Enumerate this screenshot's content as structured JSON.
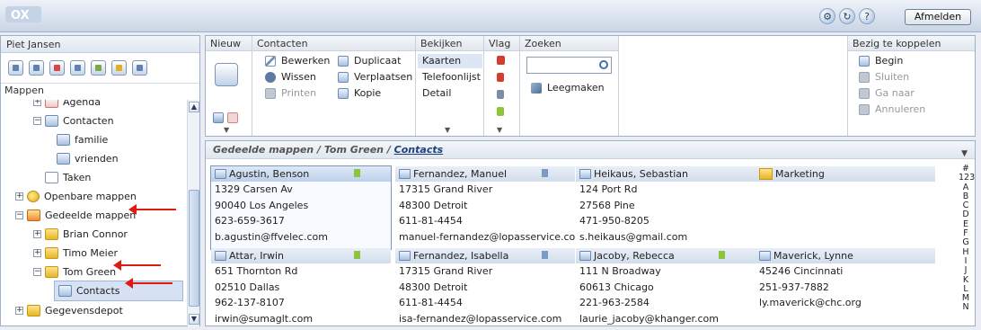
{
  "header": {
    "logo_text": "OX",
    "logout_label": "Afmelden",
    "icons": [
      "gear-icon",
      "refresh-icon",
      "help-icon"
    ]
  },
  "sidebar": {
    "user_name": "Piet Jansen",
    "folders_title": "Mappen",
    "app_icons": [
      "home-icon",
      "mail-icon",
      "calendar-icon",
      "contacts-icon",
      "tasks-icon",
      "files-icon",
      "options-icon"
    ],
    "tree": [
      {
        "label": "Agenda",
        "indent": 2
      },
      {
        "label": "Contacten",
        "indent": 2
      },
      {
        "label": "familie",
        "indent": 3
      },
      {
        "label": "vrienden",
        "indent": 3
      },
      {
        "label": "Taken",
        "indent": 2
      },
      {
        "label": "Openbare mappen",
        "indent": 1
      },
      {
        "label": "Gedeelde mappen",
        "indent": 1
      },
      {
        "label": "Brian Connor",
        "indent": 2
      },
      {
        "label": "Timo Meier",
        "indent": 2
      },
      {
        "label": "Tom Green",
        "indent": 2
      },
      {
        "label": "Contacts",
        "indent": 3
      },
      {
        "label": "Gegevensdepot",
        "indent": 1
      }
    ]
  },
  "toolbar": {
    "new_title": "Nieuw",
    "contacts_title": "Contacten",
    "edit": "Bewerken",
    "duplicate": "Duplicaat",
    "delete": "Wissen",
    "move": "Verplaatsen",
    "print": "Printen",
    "copy": "Kopie",
    "view_title": "Bekijken",
    "view_cards": "Kaarten",
    "view_phonelist": "Telefoonlijst",
    "view_detail": "Detail",
    "flag_title": "Vlag",
    "search_title": "Zoeken",
    "search_value": "",
    "clear": "Leegmaken",
    "connect_title": "Bezig te koppelen",
    "begin": "Begin",
    "close": "Sluiten",
    "goto": "Ga naar",
    "cancel": "Annuleren"
  },
  "content": {
    "breadcrumb_shared": "Gedeelde mappen",
    "breadcrumb_sep1": " / ",
    "breadcrumb_user": "Tom Green",
    "breadcrumb_sep2": " / ",
    "breadcrumb_folder": "Contacts",
    "alphabet": "#\n123\nA\nB\nC\nD\nE\nF\nG\nH\nI\nJ\nK\nL\nM\nN",
    "cards": [
      {
        "name": "Agustin, Benson",
        "l1": "1329 Carsen Av",
        "l2": "90040 Los Angeles",
        "l3": "623-659-3617",
        "l4": "b.agustin@ffvelec.com"
      },
      {
        "name": "Fernandez, Manuel",
        "l1": "17315 Grand River",
        "l2": "48300 Detroit",
        "l3": "611-81-4454",
        "l4": "manuel-fernandez@lopasservice.com"
      },
      {
        "name": "Heikaus, Sebastian",
        "l1": "124 Port Rd",
        "l2": "27568 Pine",
        "l3": "471-950-8205",
        "l4": "s.heikaus@gmail.com"
      },
      {
        "name": "Marketing",
        "l1": "",
        "l2": "",
        "l3": "",
        "l4": ""
      },
      {
        "name": "Attar, Irwin",
        "l1": "651 Thornton Rd",
        "l2": "02510 Dallas",
        "l3": "962-137-8107",
        "l4": "irwin@sumaglt.com"
      },
      {
        "name": "Fernandez, Isabella",
        "l1": "17315 Grand River",
        "l2": "48300 Detroit",
        "l3": "611-81-4454",
        "l4": "isa-fernandez@lopasservice.com"
      },
      {
        "name": "Jacoby, Rebecca",
        "l1": "111 N Broadway",
        "l2": "60613 Chicago",
        "l3": "221-963-2584",
        "l4": "laurie_jacoby@khanger.com"
      },
      {
        "name": "Maverick, Lynne",
        "l1": "45246 Cincinnati",
        "l2": "251-937-7882",
        "l3": "ly.maverick@chc.org",
        "l4": ""
      }
    ]
  }
}
